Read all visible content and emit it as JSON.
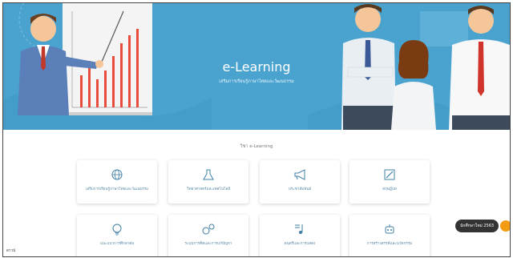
{
  "hero": {
    "title": "e-Learning",
    "subtitle": "เสริมการเรียนรู้ภาษาไทยและวัฒนธรรม"
  },
  "section": {
    "title": "วิชา e-Learning"
  },
  "cards": [
    {
      "label": "เสริมการเรียนรู้ภาษาไทยและวัฒนธรรม",
      "icon": "globe-icon"
    },
    {
      "label": "วิทยาศาสตร์และเทคโนโลยี",
      "icon": "flask-icon"
    },
    {
      "label": "ประชาสัมพันธ์",
      "icon": "megaphone-icon"
    },
    {
      "label": "ทฤษฎีบท",
      "icon": "pencil-icon"
    },
    {
      "label": "แนะแนวการศึกษาต่อ",
      "icon": "lightbulb-icon"
    },
    {
      "label": "ระบบการคิดและการแก้ปัญหา",
      "icon": "gears-icon"
    },
    {
      "label": "ดนตรีและการแสดง",
      "icon": "music-note-icon"
    },
    {
      "label": "การสร้างสรรค์และนวัตกรรม",
      "icon": "robot-icon"
    }
  ],
  "chat": {
    "label": "นักศึกษาใหม่ 2563"
  },
  "status": {
    "text": "ดาวน์"
  },
  "colors": {
    "hero": "#4aa3cf",
    "accent": "#f39c12",
    "icon": "#3f7fa6"
  }
}
